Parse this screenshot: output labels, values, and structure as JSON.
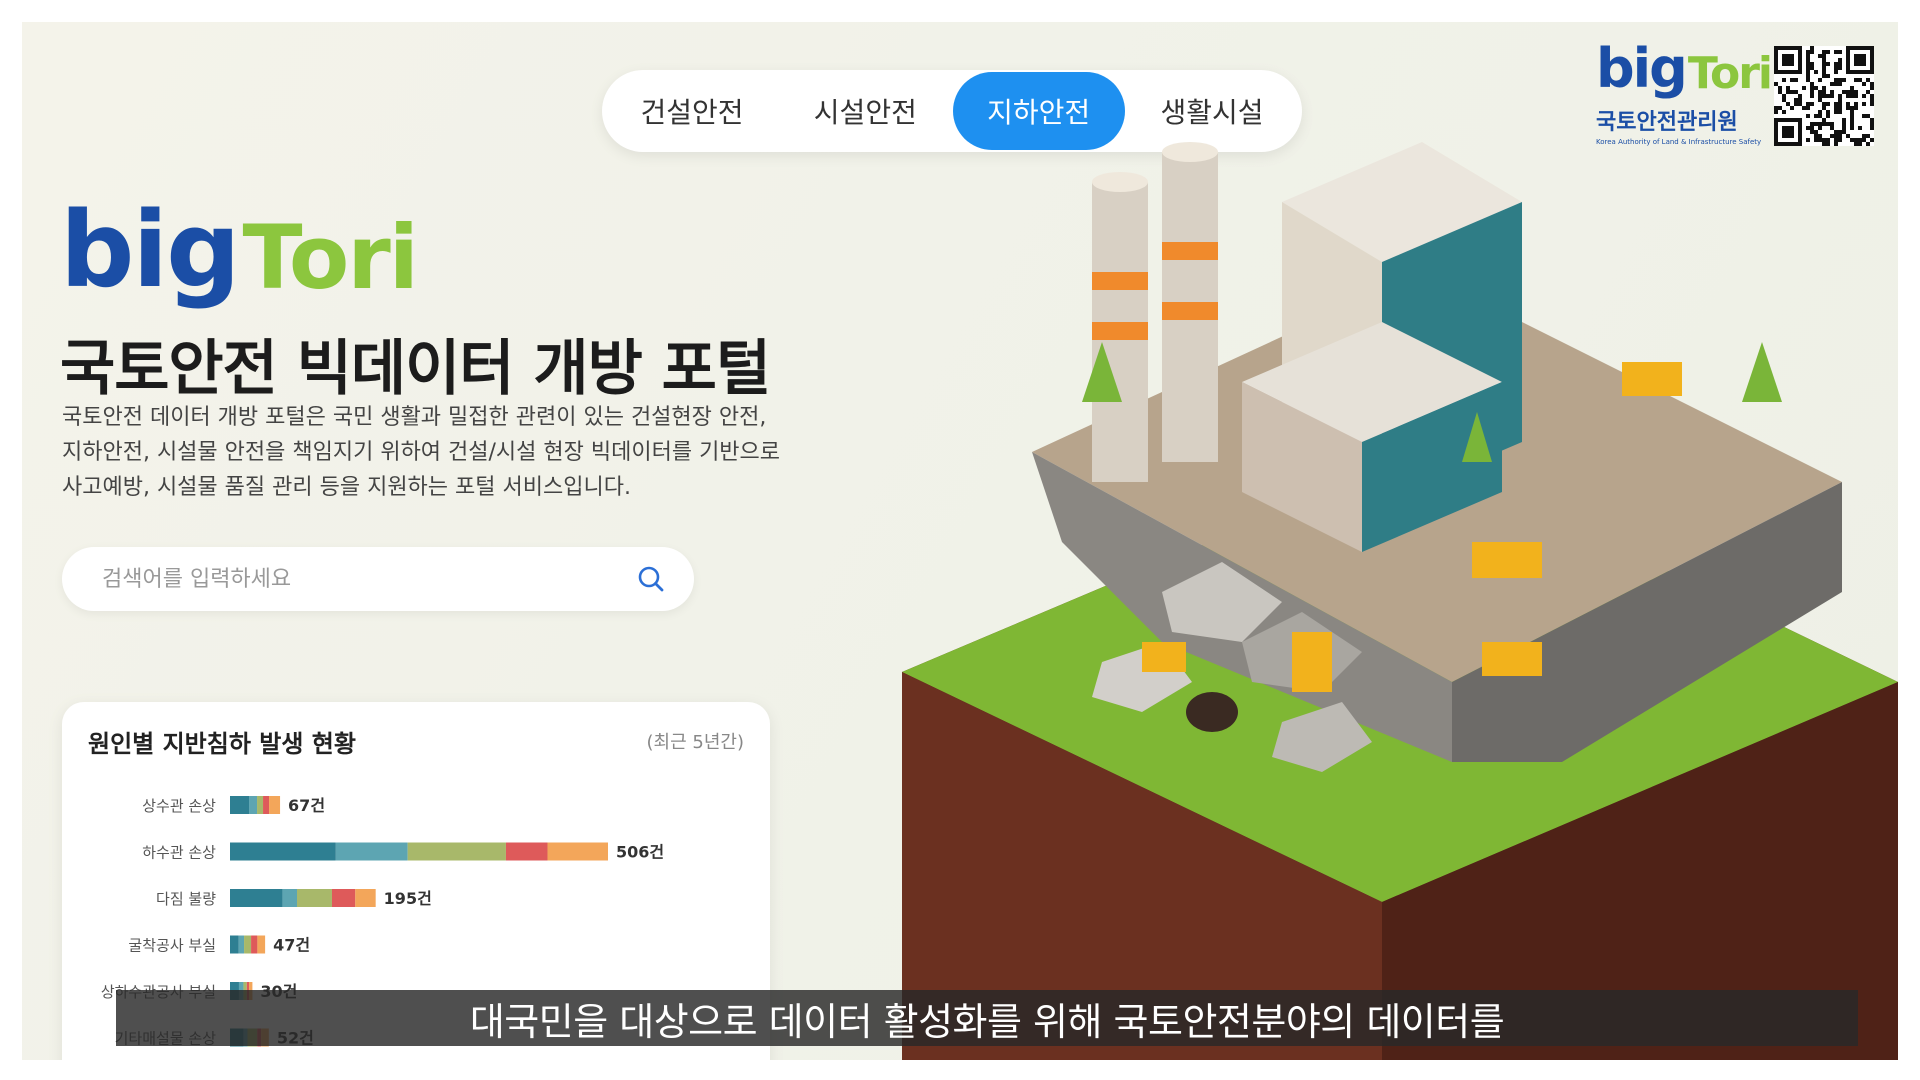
{
  "nav": {
    "tabs": [
      {
        "label": "건설안전",
        "active": false
      },
      {
        "label": "시설안전",
        "active": false
      },
      {
        "label": "지하안전",
        "active": true
      },
      {
        "label": "생활시설",
        "active": false
      }
    ]
  },
  "brand": {
    "logo_big": "big",
    "logo_tori": "Tori",
    "org_name": "국토안전관리원",
    "org_name_en": "Korea Authority of Land & Infrastructure Safety"
  },
  "hero": {
    "title": "국토안전 빅데이터 개방 포털",
    "desc_line1": "국토안전 데이터 개방 포털은 국민 생활과 밀접한 관련이 있는 건설현장 안전,",
    "desc_line2": "지하안전, 시설물 안전을 책임지기 위하여 건설/시설 현장 빅데이터를 기반으로",
    "desc_line3": "사고예방, 시설물 품질 관리 등을 지원하는 포털 서비스입니다."
  },
  "search": {
    "placeholder": "검색어를 입력하세요",
    "value": ""
  },
  "card": {
    "title": "원인별 지반침하 발생 현황",
    "note": "(최근 5년간)"
  },
  "chart_data": {
    "type": "bar",
    "orientation": "horizontal",
    "stacked": true,
    "title": "원인별 지반침하 발생 현황",
    "categories": [
      "상수관 손상",
      "하수관 손상",
      "다짐 불량",
      "굴착공사 부실",
      "상하수관공사 부실",
      "기타매설물 손상"
    ],
    "totals": [
      67,
      506,
      195,
      47,
      30,
      52
    ],
    "value_labels": [
      "67건",
      "506건",
      "195건",
      "47건",
      "30건",
      "52건"
    ],
    "series_colors": [
      "#2e7f92",
      "#5da5b2",
      "#a8b86a",
      "#de5a5a",
      "#f3a65a"
    ],
    "segment_fractions": [
      [
        0.38,
        0.16,
        0.12,
        0.12,
        0.22
      ],
      [
        0.28,
        0.19,
        0.26,
        0.11,
        0.16
      ],
      [
        0.36,
        0.1,
        0.24,
        0.16,
        0.14
      ],
      [
        0.25,
        0.15,
        0.2,
        0.18,
        0.22
      ],
      [
        0.4,
        0.2,
        0.15,
        0.1,
        0.15
      ],
      [
        0.35,
        0.1,
        0.25,
        0.1,
        0.2
      ]
    ]
  },
  "subtitle": {
    "text": "대국민을 대상으로 데이터 활성화를 위해 국토안전분야의 데이터를"
  }
}
